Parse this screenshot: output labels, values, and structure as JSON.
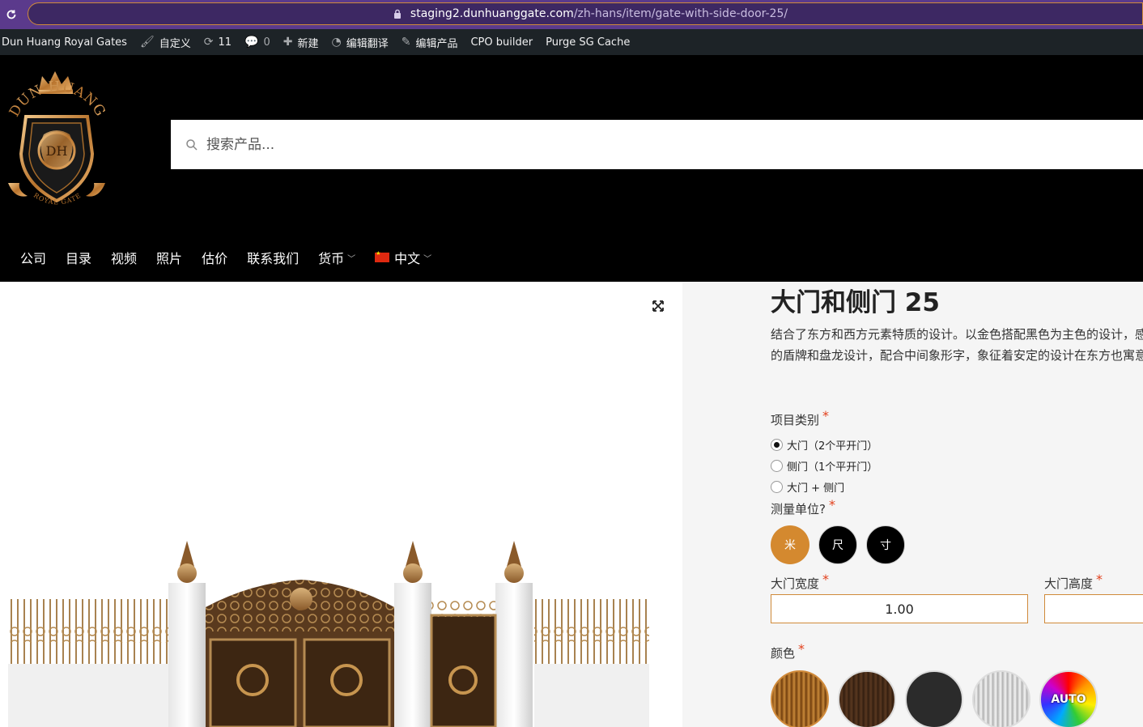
{
  "browser": {
    "url_host": "staging2.dunhuanggate.com",
    "url_path": "/zh-hans/item/gate-with-side-door-25/"
  },
  "adminbar": {
    "site_name": "Dun Huang Royal Gates",
    "customize": "自定义",
    "updates_count": "11",
    "comments_count": "0",
    "new": "新建",
    "edit_translation": "编辑翻译",
    "edit_product": "编辑产品",
    "cpo_builder": "CPO builder",
    "purge_cache": "Purge SG Cache"
  },
  "logo": {
    "text_top": "DUN HUANG",
    "text_bottom": "ROYAL GATE"
  },
  "search": {
    "placeholder": "搜索产品..."
  },
  "nav": {
    "items": [
      "公司",
      "目录",
      "视频",
      "照片",
      "估价",
      "联系我们"
    ],
    "currency": "货币",
    "language": "中文"
  },
  "product": {
    "title": "大门和侧门 25",
    "description": "结合了东方和西方元素特质的设计。以金色搭配黑色为主色的设计，感觉。正门上方的盾牌和盘龙设计，配合中间象形字，象征着安定的设计在东方也寓意着财源滚滚。",
    "item_type_label": "项目类别",
    "item_types": [
      "大门（2个平开门）",
      "侧门（1个平开门）",
      "大门 + 侧门"
    ],
    "item_type_selected": 0,
    "unit_label": "测量单位?",
    "units": [
      "米",
      "尺",
      "寸"
    ],
    "units_colors": [
      "#d4892f",
      "#000000",
      "#000000"
    ],
    "width_label": "大门宽度",
    "width_value": "1.00",
    "height_label": "大门高度",
    "height_value": "",
    "color_label": "颜色",
    "colors": [
      "bronze",
      "dark-brown",
      "black",
      "silver",
      "auto"
    ],
    "auto_label": "AUTO",
    "required_mark": "*"
  }
}
